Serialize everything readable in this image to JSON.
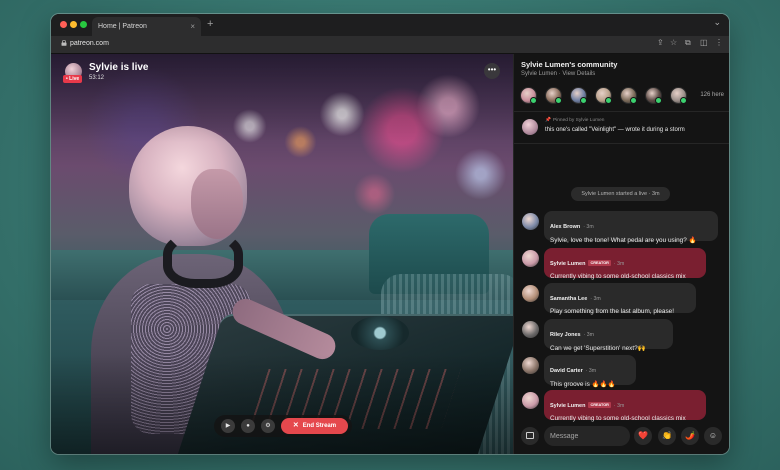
{
  "browser": {
    "tab_title": "Home | Patreon",
    "tab_close": "×",
    "new_tab": "+",
    "url": "patreon.com",
    "back_glyph": "←",
    "forward_glyph": "→",
    "reload_glyph": "↻",
    "share_glyph": "⇪",
    "star_glyph": "☆",
    "extensions_glyph": "⧉",
    "sidebar_glyph": "◫",
    "menu_glyph": "⋮",
    "tabs_dropdown_glyph": "⌄"
  },
  "stream": {
    "live_badge": "• Live",
    "title": "Sylvie is live",
    "elapsed": "53:12",
    "more_glyph": "•••",
    "controls": {
      "camera_glyph": "▶",
      "mic_glyph": "●",
      "settings_glyph": "⚙",
      "end_label": "End Stream",
      "end_glyph": "✕"
    }
  },
  "community": {
    "title": "Sylvie Lumen's community",
    "subtitle": "Sylvie Lumen · View Details",
    "viewer_count": "126 here",
    "viewer_colors": [
      "#c98f9c",
      "#8a6d5c",
      "#6f7fa3",
      "#b9a08a",
      "#7c6b5a",
      "#5b4a45",
      "#9b8f8a"
    ]
  },
  "pinned": {
    "label": "Pinned by Sylvie Lumen",
    "pin_glyph": "📌",
    "text": "this one's called \"Veinlight\" — wrote it during a storm"
  },
  "system_message": "Sylvie Lumen started a live · 3m",
  "messages": [
    {
      "name": "Alex Brown",
      "tag": "",
      "time": "3m",
      "text": "Sylvie, love the tone! What pedal are you using? 🔥",
      "creator": false,
      "avatar": "#7d8aa8"
    },
    {
      "name": "Sylvie Lumen",
      "tag": "CREATOR",
      "time": "3m",
      "text": "Currently vibing to some old-school classics mix",
      "creator": true,
      "avatar": "#c99aa8"
    },
    {
      "name": "Samantha Lee",
      "tag": "",
      "time": "3m",
      "text": "Play something from the last album, please!",
      "creator": false,
      "avatar": "#b38f78"
    },
    {
      "name": "Riley Jones",
      "tag": "",
      "time": "3m",
      "text": "Can we get 'Superstition' next?🙌",
      "creator": false,
      "avatar": "#6c6a6a"
    },
    {
      "name": "David Carter",
      "tag": "",
      "time": "3m",
      "text": "This groove is 🔥🔥🔥",
      "creator": false,
      "avatar": "#8a7468"
    },
    {
      "name": "Sylvie Lumen",
      "tag": "CREATOR",
      "time": "3m",
      "text": "Currently vibing to some old-school classics mix",
      "creator": true,
      "avatar": "#c99aa8"
    }
  ],
  "composer": {
    "placeholder": "Message",
    "reactions": [
      "❤️",
      "👏",
      "🌶️",
      "☺"
    ]
  }
}
